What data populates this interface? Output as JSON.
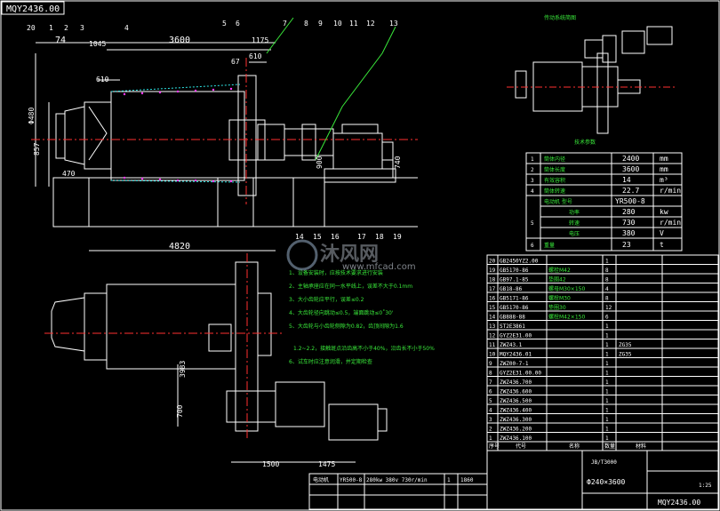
{
  "drawing_code_corner": "MQY2436.00",
  "title_block_code": "MQY2436.00",
  "title_block_name": "Ф240×3600",
  "standard": "JB/T3000",
  "colors": {
    "background": "#000000",
    "lines": "#ffffff",
    "notes": "#39e83a",
    "center": "#ff3030",
    "parts": "#ff39ff",
    "cyan": "#2ee6e6"
  },
  "balloons": [
    "20",
    "1",
    "2",
    "3",
    "4",
    "5",
    "6",
    "7",
    "8",
    "9",
    "10",
    "11",
    "12",
    "13",
    "14",
    "15",
    "16",
    "17",
    "18",
    "19"
  ],
  "top_dims": [
    "74",
    "1045",
    "3600",
    "1175",
    "610",
    "610",
    "67"
  ],
  "side_dims": [
    "Φ480",
    "857",
    "470",
    "740",
    "900"
  ],
  "plan_dims": [
    "4820",
    "3983",
    "700",
    "1500",
    "1475"
  ],
  "tech_table": {
    "title": "技术参数",
    "rows": [
      [
        "1",
        "筒体内径",
        "2400",
        "mm"
      ],
      [
        "2",
        "筒体长度",
        "3600",
        "mm"
      ],
      [
        "3",
        "有效容积",
        "14",
        "m³"
      ],
      [
        "4",
        "筒体转速",
        "22.7",
        "r/min"
      ],
      [
        "5",
        "电动机 型号",
        "YR500-8",
        ""
      ],
      [
        "",
        "功率",
        "280",
        "kw"
      ],
      [
        "",
        "转速",
        "730",
        "r/min"
      ],
      [
        "",
        "电压",
        "380",
        "V"
      ],
      [
        "6",
        "重量",
        "23",
        "t"
      ]
    ]
  },
  "notes": [
    "1、设备安装时，应按技术要求进行安装",
    "2、主轴承座应在同一水平线上，误差不大于0.1mm",
    "3、大小齿轮应平行，误差≤0.2",
    "4、大齿轮径向跳动≤0.5，端面跳动≤0˚30'",
    "5、大齿轮与小齿轮侧隙为0.82，齿顶间隙为1.6",
    "1.2~2.2，接触斑点沿齿高不小于40%，沿齿长不小于50%",
    "6、试车时应注意润滑，并定期检查"
  ],
  "bom": [
    [
      "20",
      "GB2450YZ2.00",
      "",
      "1",
      ""
    ],
    [
      "19",
      "GB5170-86",
      "螺栓M42",
      "8",
      ""
    ],
    [
      "18",
      "GB97.1-85",
      "垫圈42",
      "8",
      ""
    ],
    [
      "17",
      "GB18-86",
      "螺母M30×150",
      "4",
      ""
    ],
    [
      "16",
      "GB5171-86",
      "螺栓M30",
      "8",
      ""
    ],
    [
      "15",
      "GB5170-86",
      "垫圈30",
      "12",
      ""
    ],
    [
      "14",
      "GB888-88",
      "螺栓M42×150",
      "6",
      ""
    ],
    [
      "13",
      "ST2E3861",
      "",
      "1",
      ""
    ],
    [
      "12",
      "GYZ2E31.00",
      "",
      "1",
      ""
    ],
    [
      "11",
      "ZWZ43.1",
      "",
      "1",
      "ZG35"
    ],
    [
      "10",
      "MQY2436.01",
      "",
      "1",
      "ZG35"
    ],
    [
      "9",
      "ZWZ00-7-1",
      "",
      "1",
      ""
    ],
    [
      "8",
      "GYZ2E31.00.00",
      "",
      "1",
      ""
    ],
    [
      "7",
      "ZWZ436.700",
      "",
      "1",
      ""
    ],
    [
      "6",
      "ZWZ436.600",
      "",
      "1",
      ""
    ],
    [
      "5",
      "ZWZ436.500",
      "",
      "1",
      ""
    ],
    [
      "4",
      "ZWZ436.400",
      "",
      "1",
      ""
    ],
    [
      "3",
      "ZWZ436.300",
      "",
      "1",
      ""
    ],
    [
      "2",
      "ZWZ436.200",
      "",
      "1",
      ""
    ],
    [
      "1",
      "ZWZ436.100",
      "",
      "1",
      ""
    ]
  ],
  "bom_header": [
    "序号",
    "代号",
    "名称",
    "数量",
    "材料"
  ],
  "motor_row": [
    "电动机",
    "YR500-8",
    "280kw 380v 730r/min",
    "1",
    "1860"
  ],
  "watermark_main": "沐风网",
  "watermark_sub": "www.mfcad.com",
  "small_label_top": "传动系统简图",
  "scale_label": "1:25"
}
